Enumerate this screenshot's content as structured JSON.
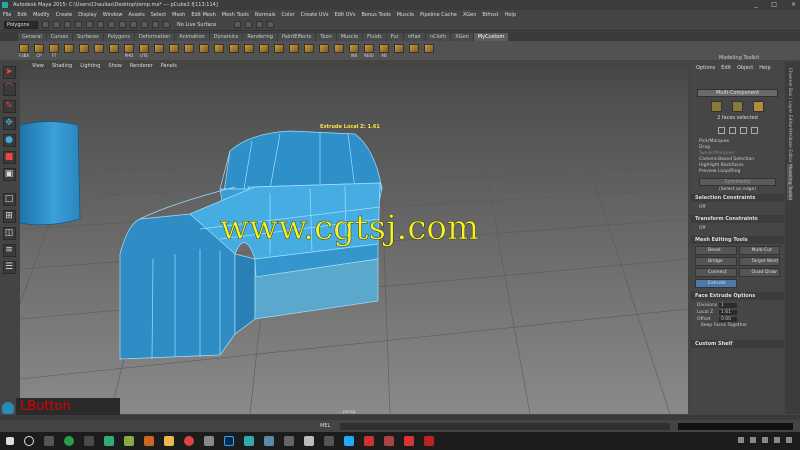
{
  "window": {
    "title": "Autodesk Maya 2015: C:\\Users\\Chaulias\\Desktop\\temp.ma*   ---   pCube2.f[113:114]",
    "controls": [
      "_",
      "□",
      "×"
    ]
  },
  "menubar": [
    "File",
    "Edit",
    "Modify",
    "Create",
    "Display",
    "Window",
    "Assets",
    "Select",
    "Mesh",
    "Edit Mesh",
    "Mesh Tools",
    "Normals",
    "Color",
    "Create UVs",
    "Edit UVs",
    "Bonus Tools",
    "Muscle",
    "Pipeline Cache",
    "XGen",
    "Bifrost",
    "Help"
  ],
  "statusline": {
    "mode": "Polygons",
    "live_surface": "No Live Surface"
  },
  "shelf_tabs": [
    "General",
    "Curves",
    "Surfaces",
    "Polygons",
    "Deformation",
    "Animation",
    "Dynamics",
    "Rendering",
    "PaintEffects",
    "Toon",
    "Muscle",
    "Fluids",
    "Fur",
    "nHair",
    "nCloth",
    "XGen",
    "MyCustom"
  ],
  "shelf_active": "MyCustom",
  "shelf_icons": [
    "F3BX",
    "CP",
    "FT",
    "",
    "",
    "",
    "",
    "PHO",
    "UTE",
    "",
    "",
    "",
    "",
    "",
    "",
    "",
    "",
    "",
    "",
    "",
    "",
    "",
    "WS",
    "REIO",
    "AB",
    "",
    "",
    ""
  ],
  "viewport_menu": [
    "View",
    "Shading",
    "Lighting",
    "Show",
    "Renderer",
    "Panels"
  ],
  "viewport": {
    "manip_label": "Extrude Local Z: 1.61",
    "camera": "persp",
    "watermark": "www.cgtsj.com"
  },
  "overlay": {
    "lbutton": "LButton"
  },
  "right_panel": {
    "menu": [
      "Options",
      "Edit",
      "Object",
      "Help"
    ],
    "title": "Modeling Toolkit",
    "multi_component": "Multi-Component",
    "faces_selected": "2 faces selected",
    "options": [
      "Pick/Marquee",
      "Drag",
      "Tweak/Marquee",
      "Camera-Based Selection",
      "Highlight Backfaces",
      "Preview Loop/Ring"
    ],
    "symmetry_btn": "Symmetry",
    "select_edge": "(Select an edge)",
    "sections": {
      "selection_constraints": "Selection Constraints",
      "off1": "Off",
      "transform_constraints": "Transform Constraints",
      "off2": "Off",
      "mesh_tools": "Mesh Editing Tools",
      "face_extrude": "Face Extrude Options",
      "custom_shelf": "Custom Shelf"
    },
    "mesh_tools": [
      "Bevel",
      "Multi-Cut",
      "Bridge",
      "Target Weld",
      "Connect",
      "Quad Draw",
      "Extrude"
    ],
    "extrude": {
      "divisions_label": "Divisions",
      "divisions": "1",
      "localz_label": "Local Z",
      "localz": "1.61",
      "offset_label": "Offset",
      "offset": "0.00",
      "keep_faces": "Keep Faces Together"
    }
  },
  "side_tabs": [
    "Channel Box / Layer Editor",
    "Attribute Editor",
    "Modeling Toolkit"
  ],
  "cmdline": {
    "label": "MEL"
  }
}
